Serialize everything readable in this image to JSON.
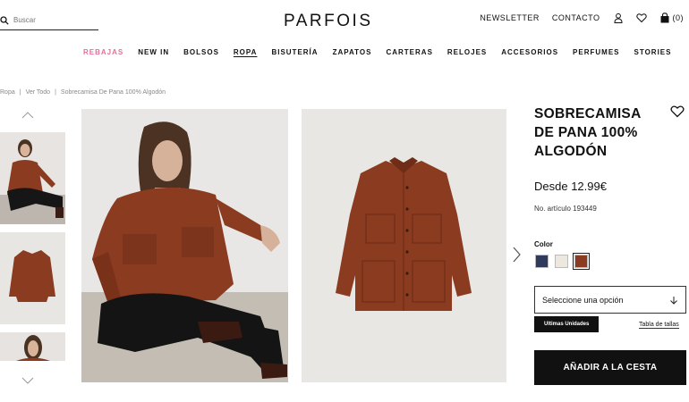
{
  "header": {
    "search_placeholder": "Buscar",
    "logo": "PARFOIS",
    "newsletter": "NEWSLETTER",
    "contact": "CONTACTO",
    "cart_count": "(0)"
  },
  "nav": {
    "items": [
      "REBAJAS",
      "NEW IN",
      "BOLSOS",
      "ROPA",
      "BISUTERÍA",
      "ZAPATOS",
      "CARTERAS",
      "RELOJES",
      "ACCESORIOS",
      "PERFUMES",
      "STORIES"
    ],
    "active": "ROPA",
    "sale_color": "#e0709a"
  },
  "breadcrumb": [
    "Ropa",
    "|",
    "Ver Todo",
    "|",
    "Sobrecamisa De Pana 100% Algodón"
  ],
  "product": {
    "title": "SOBRECAMISA DE PANA 100% ALGODÓN",
    "price": "Desde 12.99€",
    "sku": "No. artículo 193449",
    "color_label": "Color",
    "colors": [
      "#2f3a5c",
      "#ece7df",
      "#8a3b20"
    ],
    "select_placeholder": "Seleccione una opción",
    "badge": "Ultimas Unidades",
    "size_guide": "Tabla de tallas",
    "add_to_cart": "AÑADIR A LA CESTA",
    "garment_color": "#8a3b20"
  }
}
